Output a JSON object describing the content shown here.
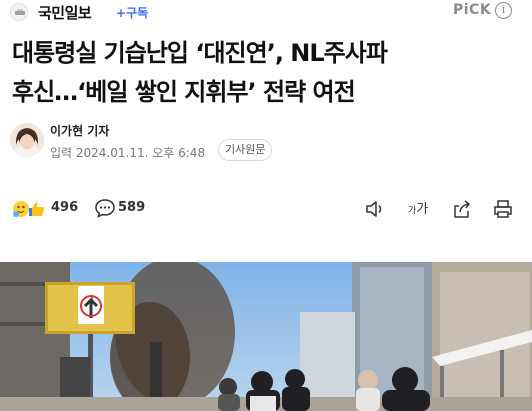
{
  "header": {
    "publisher": "국민일보",
    "subscribe_label": "+구독",
    "pick_label": "PiCK",
    "info_icon": "info-icon"
  },
  "article": {
    "headline_line1": "대통령실 기습난입 ‘대진연’, NL주사파",
    "headline_line2": "후신…‘베일 쌓인 지휘부’ 전략 여전",
    "author": "이가현 기자",
    "published": "입력 2024.01.11. 오후 6:48",
    "original_label": "기사원문"
  },
  "actions": {
    "reaction_count": "496",
    "comment_count": "589",
    "font_label_small": "가",
    "font_label_large": "가",
    "icons": [
      "emoji-reaction-icon",
      "comment-icon",
      "speaker-icon",
      "font-size-icon",
      "share-icon",
      "print-icon"
    ]
  },
  "colors": {
    "accent": "#3d6cf0",
    "text": "#111111",
    "muted": "#777777"
  }
}
